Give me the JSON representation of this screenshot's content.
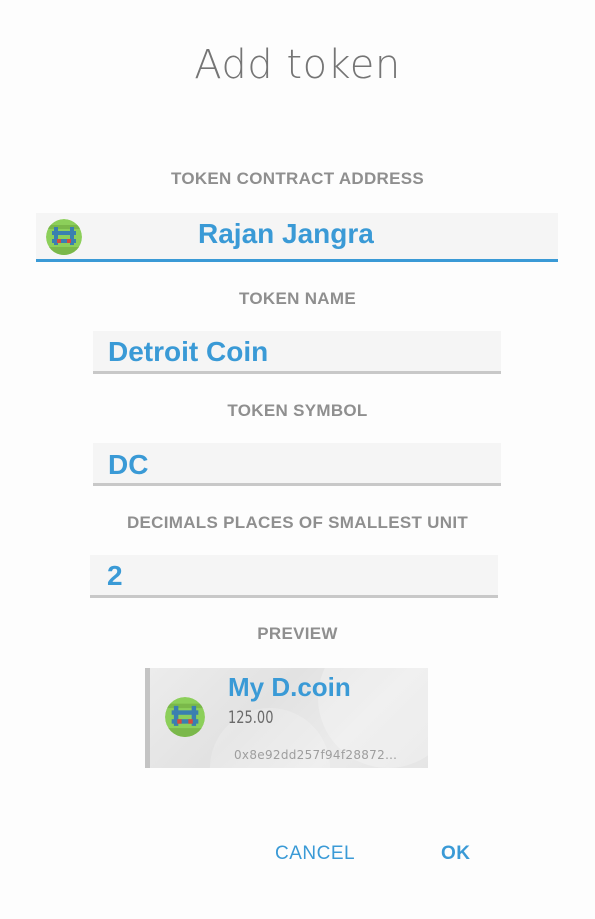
{
  "dialog": {
    "title": "Add token"
  },
  "form": {
    "contract_address": {
      "label": "TOKEN CONTRACT ADDRESS",
      "value": "Rajan Jangra",
      "icon": "identicon-avatar"
    },
    "token_name": {
      "label": "TOKEN NAME",
      "value": "Detroit Coin"
    },
    "token_symbol": {
      "label": "TOKEN SYMBOL",
      "value": "DC"
    },
    "decimals": {
      "label": "DECIMALS PLACES OF SMALLEST UNIT",
      "value": "2"
    }
  },
  "preview": {
    "label": "PREVIEW",
    "name": "My D.coin",
    "balance": "125.00",
    "address": "0x8e92dd257f94f28872…",
    "icon": "identicon-avatar"
  },
  "actions": {
    "cancel_label": "CANCEL",
    "ok_label": "OK"
  },
  "colors": {
    "accent": "#3a9ad6",
    "label": "#8f8f8f",
    "title": "#757575",
    "field_bg": "#f5f5f5",
    "field_underline": "#c8c8c8"
  }
}
